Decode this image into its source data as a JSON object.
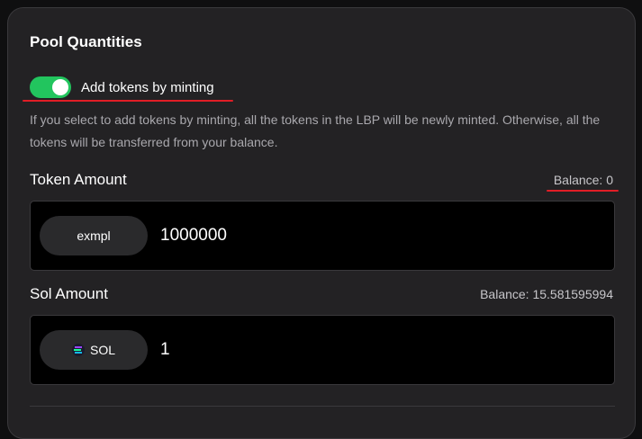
{
  "panel": {
    "title": "Pool Quantities",
    "toggle": {
      "label": "Add tokens by minting",
      "on": true,
      "color": "#22c55e"
    },
    "description": "If you select to add tokens by minting, all the tokens in the LBP will be newly minted. Otherwise, all the tokens will be transferred from your balance.",
    "token_amount": {
      "label": "Token Amount",
      "balance": "Balance: 0",
      "token_name": "exmpl",
      "value": "1000000"
    },
    "sol_amount": {
      "label": "Sol Amount",
      "balance": "Balance: 15.581595994",
      "token_name": "SOL",
      "value": "1"
    }
  },
  "colors": {
    "background": "#232224",
    "annotation_red": "#e11d26",
    "input_bg": "#000000"
  }
}
